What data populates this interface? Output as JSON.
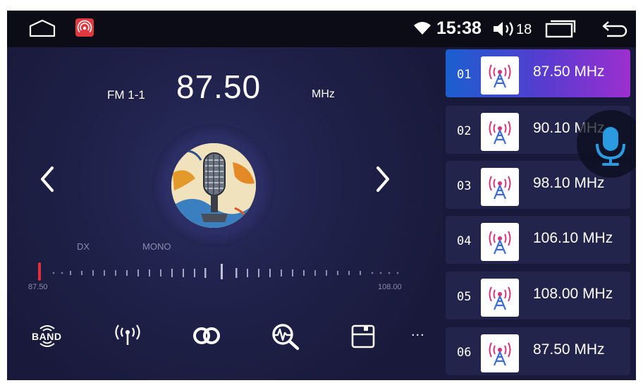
{
  "status": {
    "time": "15:38",
    "volume": "18"
  },
  "radio": {
    "band": "FM 1-1",
    "frequency": "87.50",
    "unit": "MHz",
    "dx_label": "DX",
    "mono_label": "MONO",
    "scale_min": "87.50",
    "scale_max": "108.00"
  },
  "toolbar": {
    "band_label": "BAND",
    "more": "..."
  },
  "presets": [
    {
      "num": "01",
      "freq": "87.50 MHz",
      "active": true
    },
    {
      "num": "02",
      "freq": "90.10 MHz",
      "active": false
    },
    {
      "num": "03",
      "freq": "98.10 MHz",
      "active": false
    },
    {
      "num": "04",
      "freq": "106.10 MHz",
      "active": false
    },
    {
      "num": "05",
      "freq": "108.00 MHz",
      "active": false
    },
    {
      "num": "06",
      "freq": "87.50 MHz",
      "active": false
    }
  ],
  "colors": {
    "background": "#191a3b",
    "statusbar": "#0b0c16",
    "preset_bg": "#23244c",
    "active_start": "#1a5fcf",
    "active_end": "#9c2fcf",
    "tuner_needle": "#e0303a",
    "mic_button": "#2a9be0"
  },
  "icons": {
    "home": "home-icon",
    "app": "radio-app-icon",
    "wifi": "wifi-icon",
    "volume": "volume-icon",
    "recents": "recent-apps-icon",
    "back": "back-icon",
    "mic": "microphone-icon"
  }
}
